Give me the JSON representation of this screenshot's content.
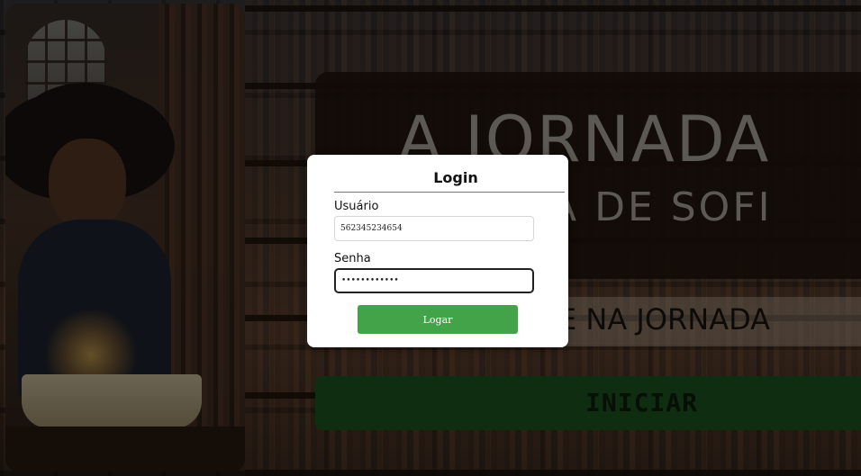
{
  "title": {
    "main": "A JORNADA",
    "sub": "A DE SOFI"
  },
  "banner": {
    "text": "E NA JORNADA"
  },
  "start_button": {
    "label": "INICIAR"
  },
  "login": {
    "title": "Login",
    "user_label": "Usuário",
    "user_value": "562345234654",
    "password_label": "Senha",
    "password_value": "••••••••••••",
    "submit_label": "Logar"
  },
  "colors": {
    "modal_bg": "#ffffff",
    "login_button": "#43a349",
    "start_button": "#1e5a23"
  }
}
